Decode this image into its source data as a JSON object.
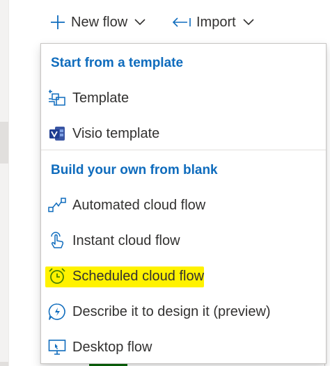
{
  "command_bar": {
    "new_flow_label": "New flow",
    "import_label": "Import"
  },
  "menu": {
    "section_template": "Start from a template",
    "section_blank": "Build your own from blank",
    "items": {
      "template": "Template",
      "visio_template": "Visio template",
      "automated": "Automated cloud flow",
      "instant": "Instant cloud flow",
      "scheduled": "Scheduled cloud flow",
      "describe": "Describe it to design it (preview)",
      "desktop": "Desktop flow"
    }
  },
  "colors": {
    "accent": "#0f6cbd",
    "highlight": "#fff200",
    "scheduled_icon": "#498205"
  },
  "icons": {
    "new_flow": "plus-icon",
    "import": "import-arrow-icon",
    "template": "template-icon",
    "visio": "visio-icon",
    "automated": "automated-flow-icon",
    "instant": "touch-icon",
    "scheduled": "alarm-clock-icon",
    "describe": "copilot-chat-icon",
    "desktop": "desktop-icon"
  }
}
